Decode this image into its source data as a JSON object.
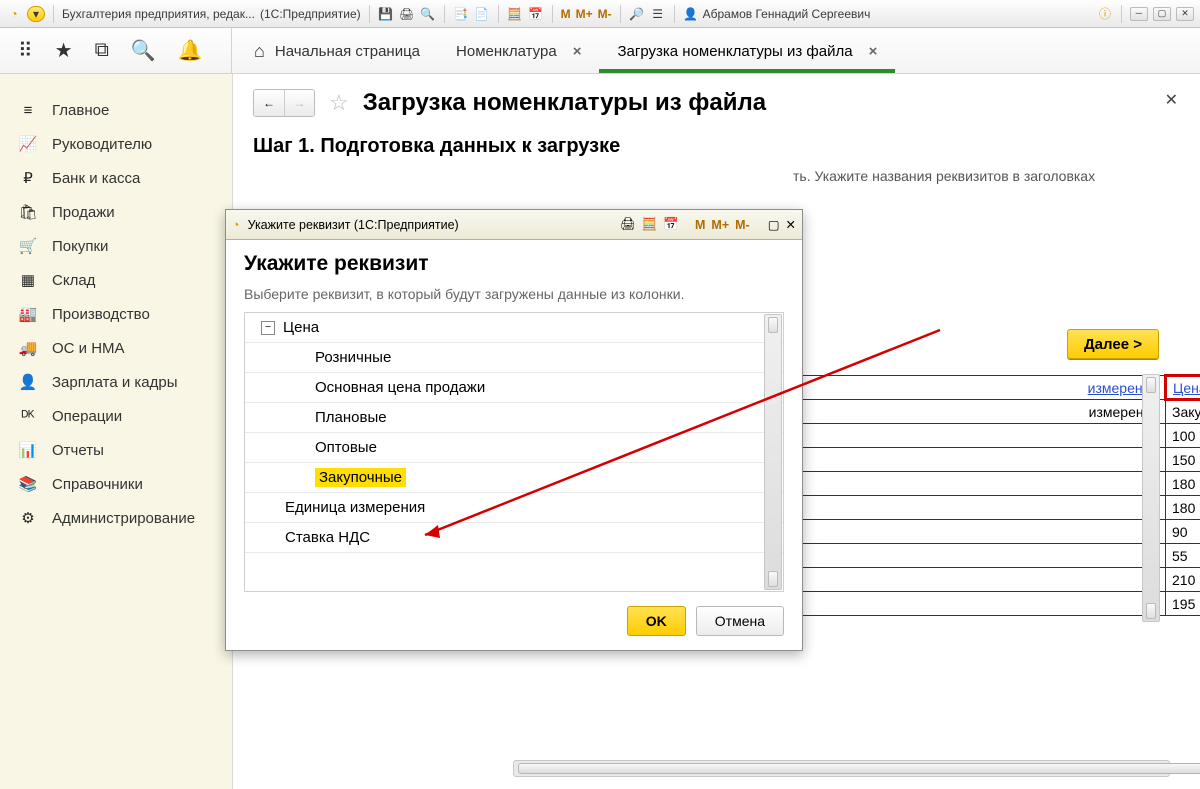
{
  "titlebar": {
    "app_title": "Бухгалтерия предприятия, редак...",
    "platform": "(1С:Предприятие)",
    "user": "Абрамов Геннадий Сергеевич",
    "m_labels": [
      "M",
      "M+",
      "M-"
    ]
  },
  "topbar": {
    "tabs": [
      {
        "label": "Начальная страница",
        "closable": false,
        "active": false,
        "home": true
      },
      {
        "label": "Номенклатура",
        "closable": true,
        "active": false
      },
      {
        "label": "Загрузка номенклатуры из файла",
        "closable": true,
        "active": true
      }
    ]
  },
  "sidebar": {
    "items": [
      {
        "icon": "≡",
        "label": "Главное"
      },
      {
        "icon": "📈",
        "label": "Руководителю"
      },
      {
        "icon": "₽",
        "label": "Банк и касса"
      },
      {
        "icon": "🛍",
        "label": "Продажи"
      },
      {
        "icon": "🛒",
        "label": "Покупки"
      },
      {
        "icon": "▦",
        "label": "Склад"
      },
      {
        "icon": "🏭",
        "label": "Производство"
      },
      {
        "icon": "🚚",
        "label": "ОС и НМА"
      },
      {
        "icon": "👤",
        "label": "Зарплата и кадры"
      },
      {
        "icon": "ᴰᴷ",
        "label": "Операции"
      },
      {
        "icon": "📊",
        "label": "Отчеты"
      },
      {
        "icon": "📚",
        "label": "Справочники"
      },
      {
        "icon": "⚙",
        "label": "Администрирование"
      }
    ]
  },
  "page": {
    "title": "Загрузка номенклатуры из файла",
    "step_title": "Шаг 1. Подготовка данных к загрузке",
    "hint_tail": "ть. Укажите названия реквизитов в заголовках",
    "next_btn": "Далее >"
  },
  "table": {
    "header1": "измерения",
    "header2": "Цена, Закупочные",
    "col1_row1": "измерения",
    "col2": [
      "Закупочные",
      "100",
      "150",
      "180",
      "180",
      "90",
      "55",
      "210",
      "195"
    ]
  },
  "dialog": {
    "win_title": "Укажите реквизит  (1С:Предприятие)",
    "m_labels": [
      "M",
      "M+",
      "M-"
    ],
    "heading": "Укажите реквизит",
    "description": "Выберите реквизит, в который будут загружены данные из колонки.",
    "tree": {
      "root": "Цена",
      "children": [
        "Розничные",
        "Основная цена продажи",
        "Плановые",
        "Оптовые",
        "Закупочные"
      ],
      "selected_index": 4,
      "after": [
        "Единица измерения",
        "Ставка НДС"
      ]
    },
    "ok": "OK",
    "cancel": "Отмена"
  }
}
